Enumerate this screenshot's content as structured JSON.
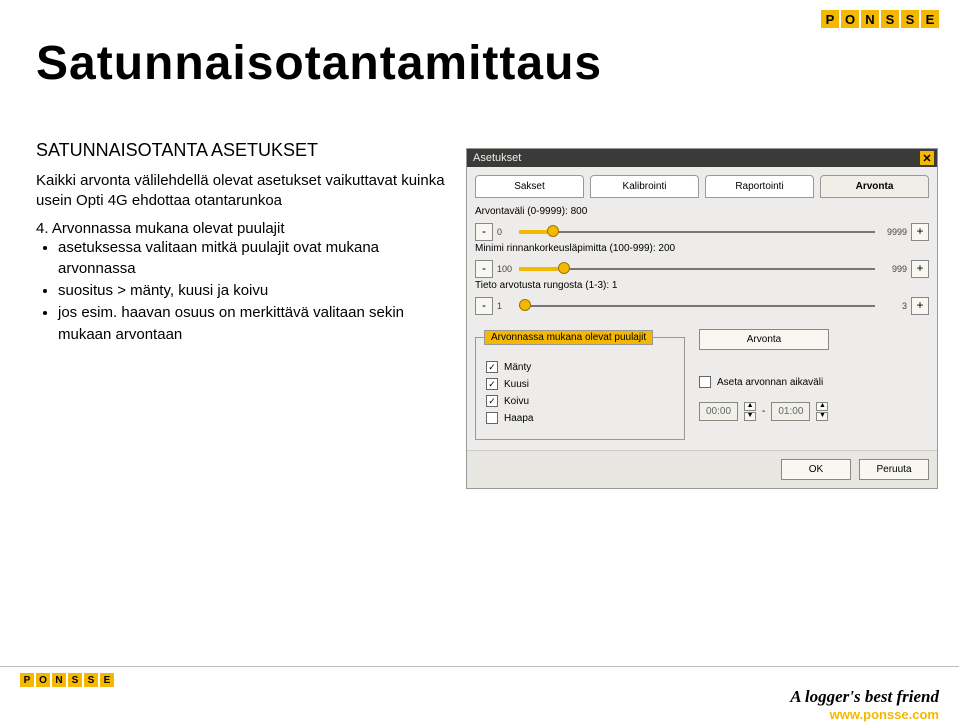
{
  "logo_letters": [
    "P",
    "O",
    "N",
    "S",
    "S",
    "E"
  ],
  "slide": {
    "title": "Satunnaisotantamittaus",
    "subhead": "SATUNNAISOTANTA ASETUKSET",
    "intro": "Kaikki arvonta välilehdellä olevat asetukset vaikuttavat kuinka usein Opti 4G ehdottaa otantarunkoa",
    "item4_head": "4. Arvonnassa mukana olevat puulajit",
    "bullets": [
      "asetuksessa valitaan mitkä puulajit ovat mukana arvonnassa",
      "suositus > mänty, kuusi ja koivu",
      "jos esim. haavan osuus on merkittävä valitaan sekin mukaan arvontaan"
    ]
  },
  "panel": {
    "title": "Asetukset",
    "tabs": [
      "Sakset",
      "Kalibrointi",
      "Raportointi",
      "Arvonta"
    ],
    "sliders": [
      {
        "label": "Arvontaväli (0-9999): 800",
        "start": "0",
        "end": "9999",
        "fillPct": 8
      },
      {
        "label": "Minimi rinnankorkeusläpimitta (100-999): 200",
        "start": "100",
        "end": "999",
        "fillPct": 11
      },
      {
        "label": "Tieto arvotusta rungosta (1-3): 1",
        "start": "1",
        "end": "3",
        "fillPct": 0
      }
    ],
    "group_legend": "Arvonnassa mukana olevat puulajit",
    "species": [
      {
        "name": "Mänty",
        "checked": true
      },
      {
        "name": "Kuusi",
        "checked": true
      },
      {
        "name": "Koivu",
        "checked": true
      },
      {
        "name": "Haapa",
        "checked": false
      }
    ],
    "arvonta_btn": "Arvonta",
    "interval_check": "Aseta arvonnan aikaväli",
    "time_from": "00:00",
    "time_to": "01:00",
    "ok": "OK",
    "cancel": "Peruuta"
  },
  "footer": {
    "tagline": "A logger's best friend",
    "url": "www.ponsse.com"
  }
}
